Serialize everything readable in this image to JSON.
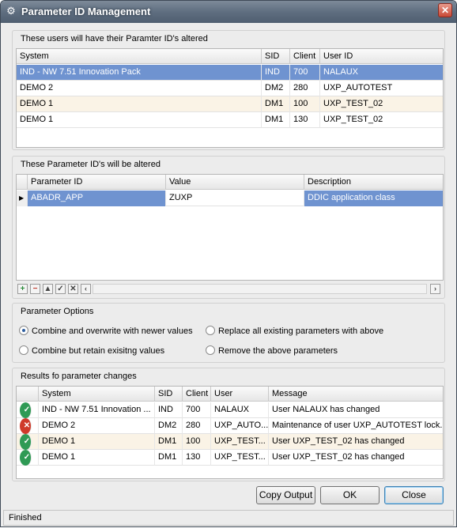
{
  "window": {
    "title": "Parameter ID Management",
    "close_glyph": "✕",
    "app_icon": "gear-icon"
  },
  "users_group": {
    "label": "These users will have their Paramter ID's altered",
    "columns": [
      "System",
      "SID",
      "Client",
      "User ID"
    ],
    "rows": [
      {
        "system": "IND - NW 7.51 Innovation Pack",
        "sid": "IND",
        "client": "700",
        "user": "NALAUX"
      },
      {
        "system": "DEMO 2",
        "sid": "DM2",
        "client": "280",
        "user": "UXP_AUTOTEST"
      },
      {
        "system": "DEMO 1",
        "sid": "DM1",
        "client": "100",
        "user": "UXP_TEST_02"
      },
      {
        "system": "DEMO 1",
        "sid": "DM1",
        "client": "130",
        "user": "UXP_TEST_02"
      }
    ]
  },
  "params_group": {
    "label": "These Parameter ID's will be altered",
    "columns": [
      "Parameter ID",
      "Value",
      "Description"
    ],
    "rows": [
      {
        "param": "ABADR_APP",
        "value": "ZUXP",
        "desc": "DDIC application class"
      }
    ]
  },
  "options_group": {
    "label": "Parameter Options",
    "options": [
      {
        "label": "Combine and overwrite with newer values",
        "selected": true
      },
      {
        "label": "Replace all existing parameters with above",
        "selected": false
      },
      {
        "label": "Combine but retain exisitng values",
        "selected": false
      },
      {
        "label": "Remove the above parameters",
        "selected": false
      }
    ]
  },
  "results_group": {
    "label": "Results fo parameter changes",
    "columns": [
      "System",
      "SID",
      "Client",
      "User",
      "Message"
    ],
    "rows": [
      {
        "status": "ok",
        "system": "IND - NW 7.51 Innovation ...",
        "sid": "IND",
        "client": "700",
        "user": "NALAUX",
        "message": "User NALAUX has changed"
      },
      {
        "status": "error",
        "system": "DEMO 2",
        "sid": "DM2",
        "client": "280",
        "user": "UXP_AUTO...",
        "message": "Maintenance of user UXP_AUTOTEST lock..."
      },
      {
        "status": "ok",
        "system": "DEMO 1",
        "sid": "DM1",
        "client": "100",
        "user": "UXP_TEST...",
        "message": "User UXP_TEST_02 has changed"
      },
      {
        "status": "ok",
        "system": "DEMO 1",
        "sid": "DM1",
        "client": "130",
        "user": "UXP_TEST...",
        "message": "User UXP_TEST_02 has changed"
      }
    ]
  },
  "buttons": {
    "copy_output": "Copy Output",
    "ok": "OK",
    "close": "Close"
  },
  "statusbar": {
    "text": "Finished"
  },
  "colors": {
    "selection": "#6f93d0",
    "ok": "#2f9a55",
    "error": "#cf3a2b",
    "titlebar": "#5f6e80"
  }
}
